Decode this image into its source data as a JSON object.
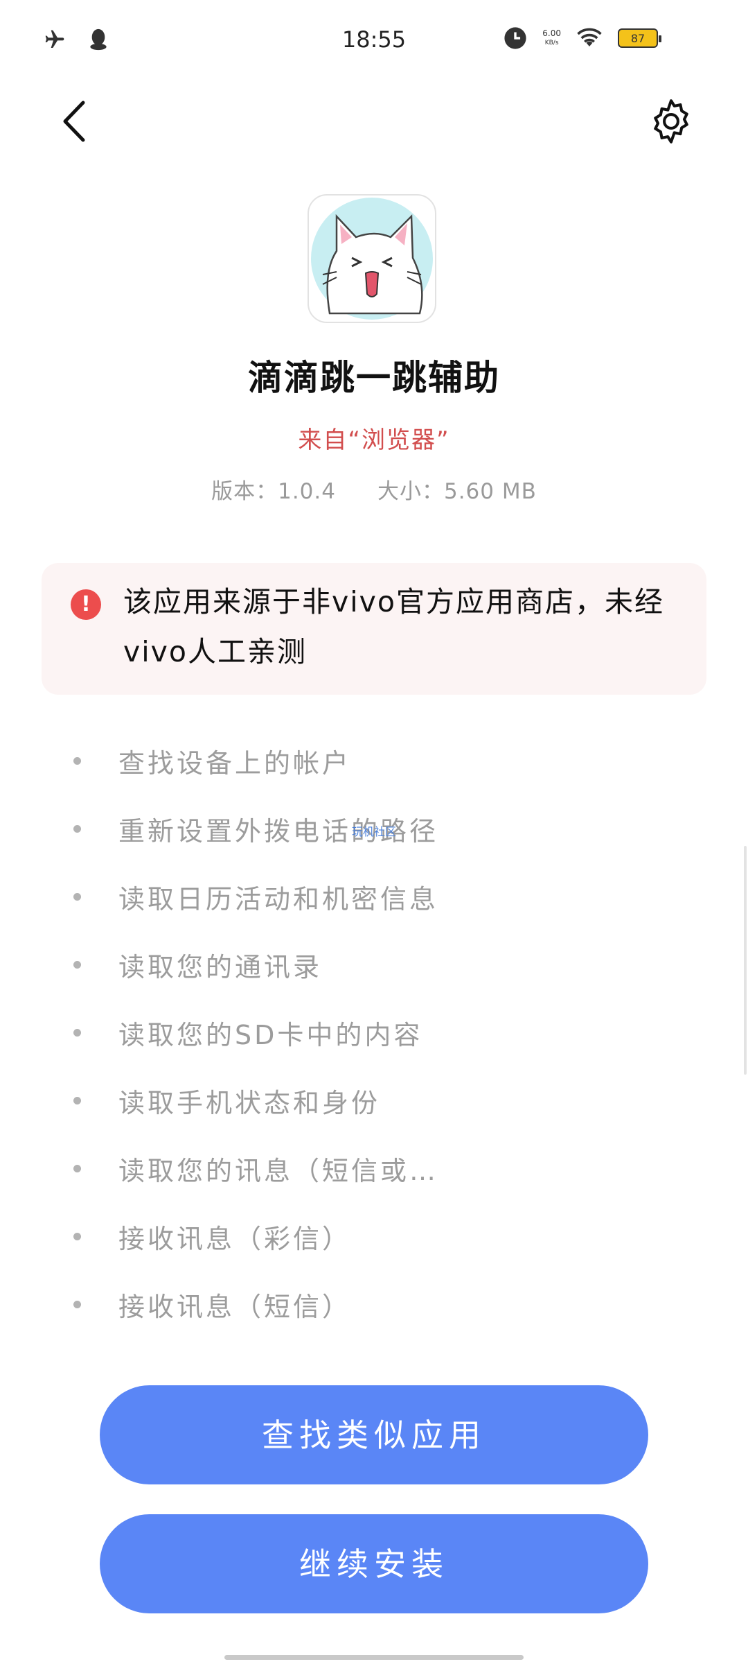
{
  "status_bar": {
    "time": "18:55",
    "net_speed_value": "6.00",
    "net_speed_unit": "KB/s",
    "battery": "87",
    "icons": [
      "airplane-icon",
      "qq-icon",
      "clock-icon",
      "wifi-icon",
      "battery-icon"
    ]
  },
  "nav": {
    "back_icon": "chevron-left-icon",
    "settings_icon": "gear-icon"
  },
  "app": {
    "name": "滴滴跳一跳辅助",
    "source": "来自“浏览器”",
    "version": "版本：1.0.4",
    "size": "大小：5.60 MB",
    "icon": "cat-icon"
  },
  "warning": {
    "icon": "exclamation-icon",
    "text": "该应用来源于非vivo官方应用商店，未经vivo人工亲测"
  },
  "permissions": [
    "查找设备上的帐户",
    "重新设置外拨电话的路径",
    "读取日历活动和机密信息",
    "读取您的通讯录",
    "读取您的SD卡中的内容",
    "读取手机状态和身份",
    "读取您的讯息（短信或…",
    "接收讯息（彩信）",
    "接收讯息（短信）"
  ],
  "watermark": "玩机社区",
  "buttons": {
    "find_similar": "查找类似应用",
    "continue_install": "继续安装"
  },
  "colors": {
    "accent": "#5a86f6",
    "warning": "#ec4d4d",
    "source_text": "#d24e4e"
  }
}
